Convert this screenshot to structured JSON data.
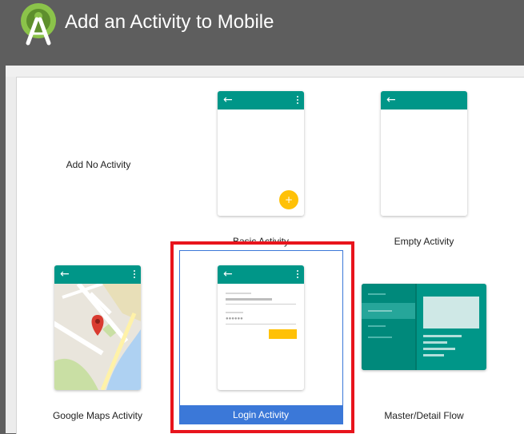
{
  "window": {
    "title": "Add an Activity to Mobile",
    "icon": "android-studio-logo-icon"
  },
  "accent_colors": {
    "app_bar": "#009688",
    "fab": "#ffc107",
    "selection": "#3b78d8",
    "highlight_frame": "#e8141c"
  },
  "templates": [
    {
      "label": "Add No Activity",
      "icon": "none"
    },
    {
      "label": "Basic Activity",
      "icon": "basic-activity-preview-icon"
    },
    {
      "label": "Empty Activity",
      "icon": "empty-activity-preview-icon"
    },
    {
      "label": "Google Maps Activity",
      "icon": "google-maps-preview-icon"
    },
    {
      "label": "Login Activity",
      "icon": "login-activity-preview-icon",
      "selected": true
    },
    {
      "label": "Master/Detail Flow",
      "icon": "master-detail-preview-icon"
    }
  ],
  "glyphs": {
    "back": "←",
    "fab_plus": "+"
  }
}
